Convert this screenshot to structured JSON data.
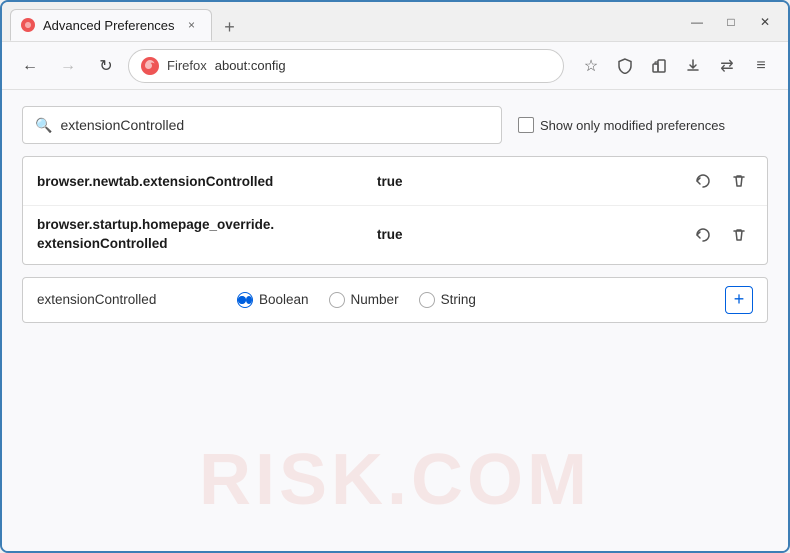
{
  "window": {
    "title": "Advanced Preferences",
    "tab_close": "×",
    "tab_new": "+",
    "win_minimize": "—",
    "win_maximize": "□",
    "win_close": "✕"
  },
  "nav": {
    "back_arrow": "←",
    "forward_arrow": "→",
    "reload": "↻",
    "browser_name": "Firefox",
    "url": "about:config",
    "star_icon": "☆",
    "shield_icon": "🛡",
    "extension_icon": "🧩",
    "download_icon": "📥",
    "sync_icon": "⇄",
    "menu_icon": "≡"
  },
  "search": {
    "placeholder": "extensionControlled",
    "value": "extensionControlled",
    "show_modified_label": "Show only modified preferences",
    "search_icon": "🔍"
  },
  "results": [
    {
      "name": "browser.newtab.extensionControlled",
      "value": "true",
      "reset_icon": "⇄",
      "delete_icon": "🗑"
    },
    {
      "name": "browser.startup.homepage_override.\nextensionControlled",
      "name_line1": "browser.startup.homepage_override.",
      "name_line2": "extensionControlled",
      "value": "true",
      "reset_icon": "⇄",
      "delete_icon": "🗑"
    }
  ],
  "new_pref": {
    "name": "extensionControlled",
    "types": [
      {
        "label": "Boolean",
        "selected": true
      },
      {
        "label": "Number",
        "selected": false
      },
      {
        "label": "String",
        "selected": false
      }
    ],
    "add_icon": "+"
  },
  "watermark": "RISK.COM"
}
